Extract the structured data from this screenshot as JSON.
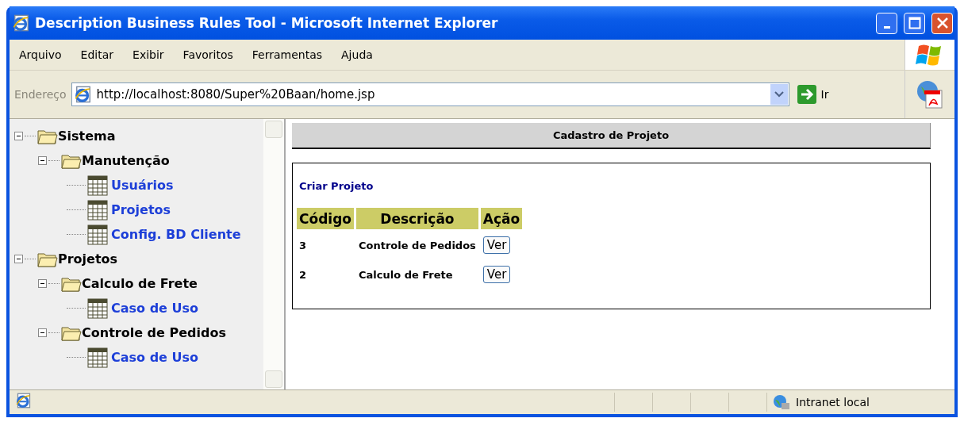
{
  "window": {
    "title": "Description Business Rules Tool - Microsoft Internet Explorer"
  },
  "menu": [
    "Arquivo",
    "Editar",
    "Exibir",
    "Favoritos",
    "Ferramentas",
    "Ajuda"
  ],
  "address_bar": {
    "label": "Endereço",
    "value": "http://localhost:8080/Super%20Baan/home.jsp",
    "go_label": "Ir"
  },
  "tree": [
    {
      "label": "Sistema",
      "kind": "folder",
      "expanded": true,
      "children": [
        {
          "label": "Manutenção",
          "kind": "folder",
          "expanded": true,
          "children": [
            {
              "label": "Usuários",
              "kind": "table"
            },
            {
              "label": "Projetos",
              "kind": "table"
            },
            {
              "label": "Config. BD Cliente",
              "kind": "table"
            }
          ]
        }
      ]
    },
    {
      "label": "Projetos",
      "kind": "folder",
      "expanded": true,
      "children": [
        {
          "label": "Calculo de Frete",
          "kind": "folder",
          "expanded": true,
          "children": [
            {
              "label": "Caso de Uso",
              "kind": "table"
            }
          ]
        },
        {
          "label": "Controle de Pedidos",
          "kind": "folder",
          "expanded": true,
          "children": [
            {
              "label": "Caso de Uso",
              "kind": "table"
            }
          ]
        }
      ]
    }
  ],
  "page": {
    "heading": "Cadastro de Projeto",
    "create_link": "Criar Projeto",
    "table": {
      "columns": [
        "Código",
        "Descrição",
        "Ação"
      ],
      "rows": [
        {
          "code": "3",
          "description": "Controle de Pedidos",
          "action": "Ver"
        },
        {
          "code": "2",
          "description": "Calculo de Frete",
          "action": "Ver"
        }
      ]
    }
  },
  "status_bar": {
    "zone": "Intranet local"
  }
}
